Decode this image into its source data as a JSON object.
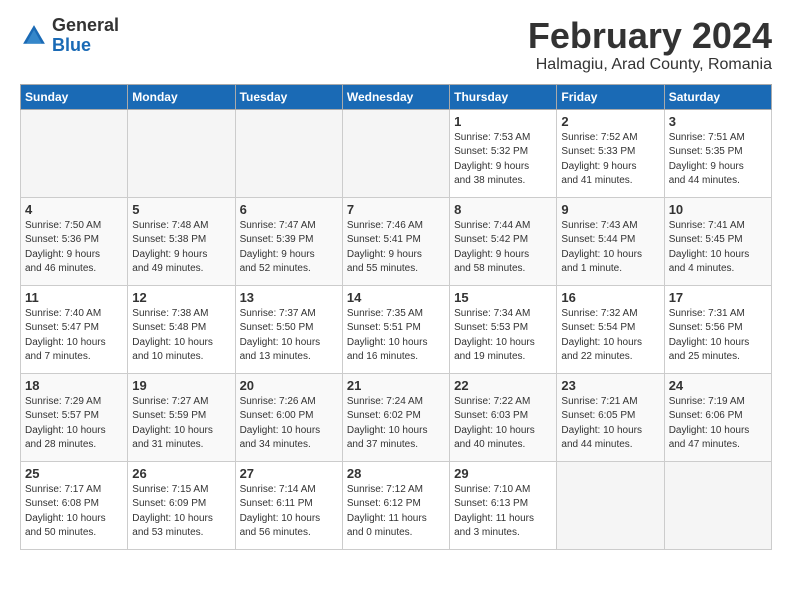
{
  "header": {
    "logo_general": "General",
    "logo_blue": "Blue",
    "month_title": "February 2024",
    "subtitle": "Halmagiu, Arad County, Romania"
  },
  "days_of_week": [
    "Sunday",
    "Monday",
    "Tuesday",
    "Wednesday",
    "Thursday",
    "Friday",
    "Saturday"
  ],
  "weeks": [
    [
      {
        "day": "",
        "info": ""
      },
      {
        "day": "",
        "info": ""
      },
      {
        "day": "",
        "info": ""
      },
      {
        "day": "",
        "info": ""
      },
      {
        "day": "1",
        "info": "Sunrise: 7:53 AM\nSunset: 5:32 PM\nDaylight: 9 hours\nand 38 minutes."
      },
      {
        "day": "2",
        "info": "Sunrise: 7:52 AM\nSunset: 5:33 PM\nDaylight: 9 hours\nand 41 minutes."
      },
      {
        "day": "3",
        "info": "Sunrise: 7:51 AM\nSunset: 5:35 PM\nDaylight: 9 hours\nand 44 minutes."
      }
    ],
    [
      {
        "day": "4",
        "info": "Sunrise: 7:50 AM\nSunset: 5:36 PM\nDaylight: 9 hours\nand 46 minutes."
      },
      {
        "day": "5",
        "info": "Sunrise: 7:48 AM\nSunset: 5:38 PM\nDaylight: 9 hours\nand 49 minutes."
      },
      {
        "day": "6",
        "info": "Sunrise: 7:47 AM\nSunset: 5:39 PM\nDaylight: 9 hours\nand 52 minutes."
      },
      {
        "day": "7",
        "info": "Sunrise: 7:46 AM\nSunset: 5:41 PM\nDaylight: 9 hours\nand 55 minutes."
      },
      {
        "day": "8",
        "info": "Sunrise: 7:44 AM\nSunset: 5:42 PM\nDaylight: 9 hours\nand 58 minutes."
      },
      {
        "day": "9",
        "info": "Sunrise: 7:43 AM\nSunset: 5:44 PM\nDaylight: 10 hours\nand 1 minute."
      },
      {
        "day": "10",
        "info": "Sunrise: 7:41 AM\nSunset: 5:45 PM\nDaylight: 10 hours\nand 4 minutes."
      }
    ],
    [
      {
        "day": "11",
        "info": "Sunrise: 7:40 AM\nSunset: 5:47 PM\nDaylight: 10 hours\nand 7 minutes."
      },
      {
        "day": "12",
        "info": "Sunrise: 7:38 AM\nSunset: 5:48 PM\nDaylight: 10 hours\nand 10 minutes."
      },
      {
        "day": "13",
        "info": "Sunrise: 7:37 AM\nSunset: 5:50 PM\nDaylight: 10 hours\nand 13 minutes."
      },
      {
        "day": "14",
        "info": "Sunrise: 7:35 AM\nSunset: 5:51 PM\nDaylight: 10 hours\nand 16 minutes."
      },
      {
        "day": "15",
        "info": "Sunrise: 7:34 AM\nSunset: 5:53 PM\nDaylight: 10 hours\nand 19 minutes."
      },
      {
        "day": "16",
        "info": "Sunrise: 7:32 AM\nSunset: 5:54 PM\nDaylight: 10 hours\nand 22 minutes."
      },
      {
        "day": "17",
        "info": "Sunrise: 7:31 AM\nSunset: 5:56 PM\nDaylight: 10 hours\nand 25 minutes."
      }
    ],
    [
      {
        "day": "18",
        "info": "Sunrise: 7:29 AM\nSunset: 5:57 PM\nDaylight: 10 hours\nand 28 minutes."
      },
      {
        "day": "19",
        "info": "Sunrise: 7:27 AM\nSunset: 5:59 PM\nDaylight: 10 hours\nand 31 minutes."
      },
      {
        "day": "20",
        "info": "Sunrise: 7:26 AM\nSunset: 6:00 PM\nDaylight: 10 hours\nand 34 minutes."
      },
      {
        "day": "21",
        "info": "Sunrise: 7:24 AM\nSunset: 6:02 PM\nDaylight: 10 hours\nand 37 minutes."
      },
      {
        "day": "22",
        "info": "Sunrise: 7:22 AM\nSunset: 6:03 PM\nDaylight: 10 hours\nand 40 minutes."
      },
      {
        "day": "23",
        "info": "Sunrise: 7:21 AM\nSunset: 6:05 PM\nDaylight: 10 hours\nand 44 minutes."
      },
      {
        "day": "24",
        "info": "Sunrise: 7:19 AM\nSunset: 6:06 PM\nDaylight: 10 hours\nand 47 minutes."
      }
    ],
    [
      {
        "day": "25",
        "info": "Sunrise: 7:17 AM\nSunset: 6:08 PM\nDaylight: 10 hours\nand 50 minutes."
      },
      {
        "day": "26",
        "info": "Sunrise: 7:15 AM\nSunset: 6:09 PM\nDaylight: 10 hours\nand 53 minutes."
      },
      {
        "day": "27",
        "info": "Sunrise: 7:14 AM\nSunset: 6:11 PM\nDaylight: 10 hours\nand 56 minutes."
      },
      {
        "day": "28",
        "info": "Sunrise: 7:12 AM\nSunset: 6:12 PM\nDaylight: 11 hours\nand 0 minutes."
      },
      {
        "day": "29",
        "info": "Sunrise: 7:10 AM\nSunset: 6:13 PM\nDaylight: 11 hours\nand 3 minutes."
      },
      {
        "day": "",
        "info": ""
      },
      {
        "day": "",
        "info": ""
      }
    ]
  ]
}
